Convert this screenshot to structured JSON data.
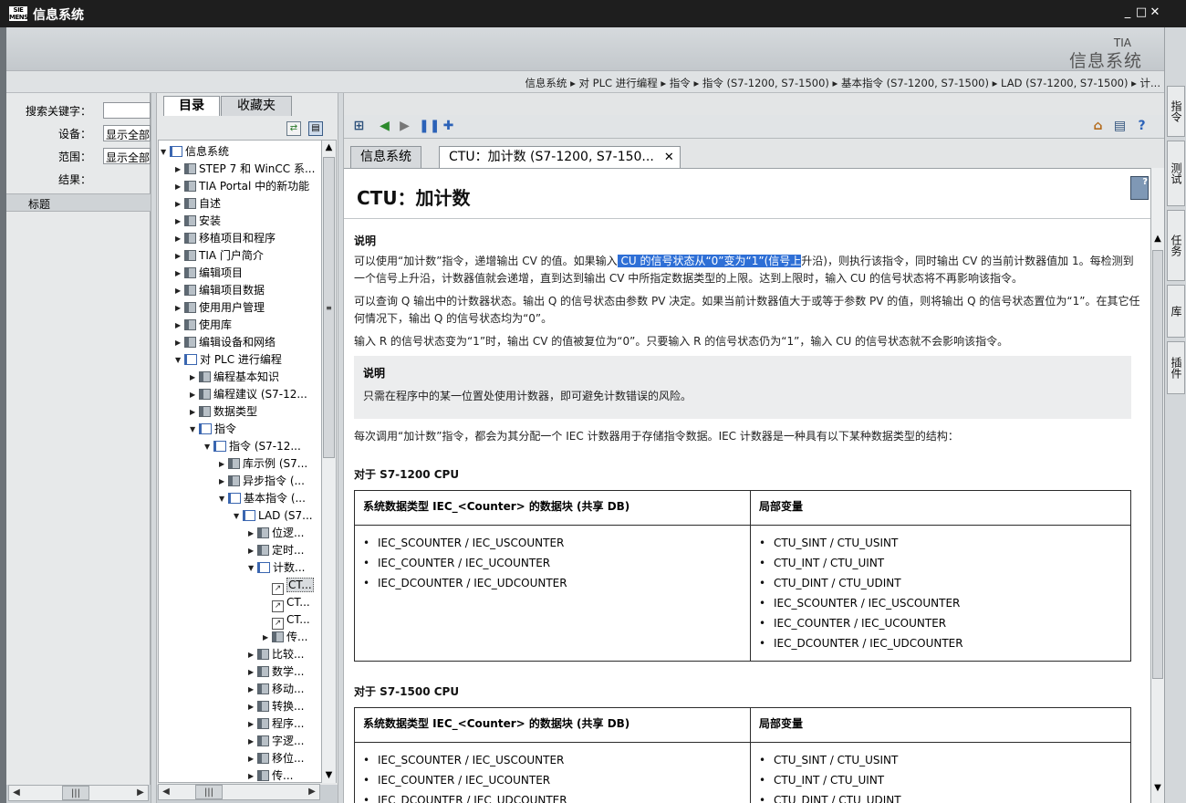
{
  "window": {
    "title": "信息系统",
    "logo_text": "SIMATIC",
    "min": "_",
    "max": "□",
    "close": "✕"
  },
  "banner": {
    "brand_small": "TIA",
    "brand": "信息系统"
  },
  "breadcrumb": "信息系统 ▸ 对 PLC 进行编程 ▸ 指令 ▸ 指令 (S7-1200, S7-1500) ▸ 基本指令 (S7-1200, S7-1500) ▸ LAD (S7-1200, S7-1500) ▸ 计...",
  "right_dock": [
    "指令",
    "测试",
    "任务",
    "库",
    "插件"
  ],
  "search": {
    "keyword_label": "搜索关键字：",
    "keyword_value": "",
    "device_label": "设备：",
    "device_value": "显示全部",
    "scope_label": "范围：",
    "scope_value": "显示全部",
    "results_label": "结果：",
    "col_title": "标题"
  },
  "tree_tabs": {
    "contents": "目录",
    "favorites": "收藏夹"
  },
  "tree": [
    {
      "label": "信息系统",
      "level": 0,
      "state": "open",
      "icon": "book"
    },
    {
      "label": "STEP 7 和 WinCC 系...",
      "level": 1,
      "state": "closed",
      "icon": "node"
    },
    {
      "label": "TIA Portal 中的新功能",
      "level": 1,
      "state": "closed",
      "icon": "node"
    },
    {
      "label": "自述",
      "level": 1,
      "state": "closed",
      "icon": "node"
    },
    {
      "label": "安装",
      "level": 1,
      "state": "closed",
      "icon": "node"
    },
    {
      "label": "移植项目和程序",
      "level": 1,
      "state": "closed",
      "icon": "node"
    },
    {
      "label": "TIA 门户简介",
      "level": 1,
      "state": "closed",
      "icon": "node"
    },
    {
      "label": "编辑项目",
      "level": 1,
      "state": "closed",
      "icon": "node"
    },
    {
      "label": "编辑项目数据",
      "level": 1,
      "state": "closed",
      "icon": "node"
    },
    {
      "label": "使用用户管理",
      "level": 1,
      "state": "closed",
      "icon": "node"
    },
    {
      "label": "使用库",
      "level": 1,
      "state": "closed",
      "icon": "node"
    },
    {
      "label": "编辑设备和网络",
      "level": 1,
      "state": "closed",
      "icon": "node"
    },
    {
      "label": "对 PLC 进行编程",
      "level": 1,
      "state": "open",
      "icon": "book"
    },
    {
      "label": "编程基本知识",
      "level": 2,
      "state": "closed",
      "icon": "node"
    },
    {
      "label": "编程建议 (S7-12...",
      "level": 2,
      "state": "closed",
      "icon": "node"
    },
    {
      "label": "数据类型",
      "level": 2,
      "state": "closed",
      "icon": "node"
    },
    {
      "label": "指令",
      "level": 2,
      "state": "open",
      "icon": "book"
    },
    {
      "label": "指令 (S7-12...",
      "level": 3,
      "state": "open",
      "icon": "book"
    },
    {
      "label": "库示例 (S7...",
      "level": 4,
      "state": "closed",
      "icon": "node"
    },
    {
      "label": "异步指令 (...",
      "level": 4,
      "state": "closed",
      "icon": "node"
    },
    {
      "label": "基本指令 (...",
      "level": 4,
      "state": "open",
      "icon": "book"
    },
    {
      "label": "LAD (S7...",
      "level": 5,
      "state": "open",
      "icon": "book"
    },
    {
      "label": "位逻...",
      "level": 6,
      "state": "closed",
      "icon": "node"
    },
    {
      "label": "定时...",
      "level": 6,
      "state": "closed",
      "icon": "node"
    },
    {
      "label": "计数...",
      "level": 6,
      "state": "open",
      "icon": "book"
    },
    {
      "label": "CT...",
      "level": 7,
      "state": "leaf",
      "icon": "link",
      "selected": true
    },
    {
      "label": "CT...",
      "level": 7,
      "state": "leaf",
      "icon": "link"
    },
    {
      "label": "CT...",
      "level": 7,
      "state": "leaf",
      "icon": "link"
    },
    {
      "label": "传...",
      "level": 7,
      "state": "closed",
      "icon": "node"
    },
    {
      "label": "比较...",
      "level": 6,
      "state": "closed",
      "icon": "node"
    },
    {
      "label": "数学...",
      "level": 6,
      "state": "closed",
      "icon": "node"
    },
    {
      "label": "移动...",
      "level": 6,
      "state": "closed",
      "icon": "node"
    },
    {
      "label": "转换...",
      "level": 6,
      "state": "closed",
      "icon": "node"
    },
    {
      "label": "程序...",
      "level": 6,
      "state": "closed",
      "icon": "node"
    },
    {
      "label": "字逻...",
      "level": 6,
      "state": "closed",
      "icon": "node"
    },
    {
      "label": "移位...",
      "level": 6,
      "state": "closed",
      "icon": "node"
    },
    {
      "label": "传...",
      "level": 6,
      "state": "closed",
      "icon": "node"
    }
  ],
  "content_tabs": {
    "tab1": "信息系统",
    "tab2": "CTU：加计数 (S7-1200, S7-150...",
    "tab2_close": "✕"
  },
  "doc": {
    "title": "CTU：加计数",
    "desc_heading": "说明",
    "para1_a": "可以使用“加计数”指令，递增输出 CV 的值。如果输入",
    "para1_hl": " CU 的信号状态从“0”变为“1”(信号上",
    "para1_b": "升沿)，则执行该指令，同时输出 CV 的当前计数器值加 1。每检测到一个信号上升沿，计数器值就会递增，直到达到输出 CV 中所指定数据类型的上限。达到上限时，输入 CU 的信号状态将不再影响该指令。",
    "para2": "可以查询 Q 输出中的计数器状态。输出 Q 的信号状态由参数 PV 决定。如果当前计数器值大于或等于参数 PV 的值，则将输出 Q 的信号状态置位为“1”。在其它任何情况下，输出 Q 的信号状态均为“0”。",
    "para3": "输入 R 的信号状态变为“1”时，输出 CV 的值被复位为“0”。只要输入 R 的信号状态仍为“1”，输入 CU 的信号状态就不会影响该指令。",
    "note_heading": "说明",
    "note_text": "只需在程序中的某一位置处使用计数器，即可避免计数错误的风险。",
    "para4": "每次调用“加计数”指令，都会为其分配一个 IEC 计数器用于存储指令数据。IEC 计数器是一种具有以下某种数据类型的结构：",
    "s1200_heading": "对于 S7-1200 CPU",
    "s1500_heading": "对于 S7-1500 CPU",
    "col1_header": "系统数据类型 IEC_<Counter> 的数据块 (共享 DB)",
    "col2_header": "局部变量",
    "t1_col1": [
      "IEC_SCOUNTER / IEC_USCOUNTER",
      "IEC_COUNTER / IEC_UCOUNTER",
      "IEC_DCOUNTER / IEC_UDCOUNTER"
    ],
    "t1_col2": [
      "CTU_SINT / CTU_USINT",
      "CTU_INT / CTU_UINT",
      "CTU_DINT / CTU_UDINT",
      "IEC_SCOUNTER / IEC_USCOUNTER",
      "IEC_COUNTER / IEC_UCOUNTER",
      "IEC_DCOUNTER / IEC_UDCOUNTER"
    ],
    "t2_col1": [
      "IEC_SCOUNTER / IEC_USCOUNTER",
      "IEC_COUNTER / IEC_UCOUNTER",
      "IEC_DCOUNTER / IEC_UDCOUNTER"
    ],
    "t2_col2": [
      "CTU_SINT / CTU_USINT",
      "CTU_INT / CTU_UINT",
      "CTU_DINT / CTU_UDINT"
    ]
  }
}
